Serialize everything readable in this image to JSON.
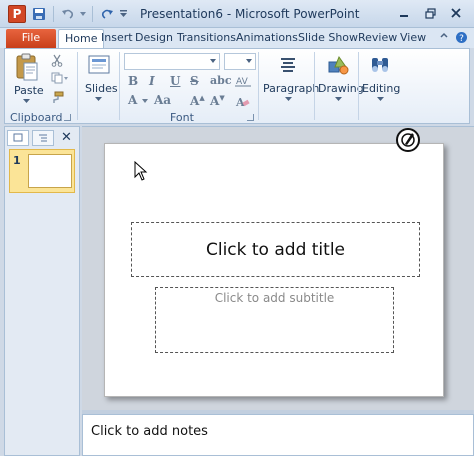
{
  "window": {
    "title": "Presentation6 - Microsoft PowerPoint",
    "app_icon_letter": "P"
  },
  "tabs": {
    "file": "File",
    "items": [
      "Home",
      "Insert",
      "Design",
      "Transitions",
      "Animations",
      "Slide Show",
      "Review",
      "View"
    ],
    "active": "Home"
  },
  "ribbon": {
    "clipboard": {
      "paste_label": "Paste",
      "group_label": "Clipboard"
    },
    "slides": {
      "label": "Slides"
    },
    "font": {
      "group_label": "Font",
      "font_name": "",
      "font_size": ""
    },
    "paragraph": {
      "label": "Paragraph"
    },
    "drawing": {
      "label": "Drawing"
    },
    "editing": {
      "label": "Editing"
    }
  },
  "slide_pane": {
    "slide_number": "1"
  },
  "slide": {
    "title_placeholder": "Click to add title",
    "subtitle_placeholder": "Click to add subtitle"
  },
  "notes": {
    "placeholder": "Click to add notes"
  },
  "colors": {
    "file_tab": "#d24726",
    "ribbon_text": "#1e395b",
    "selected_thumb": "#fbe497"
  }
}
